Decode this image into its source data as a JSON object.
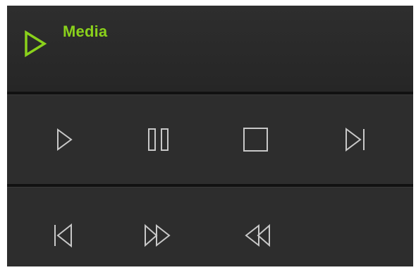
{
  "header": {
    "title": "Media",
    "icon": "play-icon",
    "accent_color": "#8ad11b"
  },
  "controls": {
    "row1": [
      "play-icon",
      "pause-icon",
      "stop-icon",
      "skip-next-icon"
    ],
    "row2": [
      "skip-previous-icon",
      "fast-forward-icon",
      "rewind-icon"
    ],
    "icon_color": "#c8c8c8"
  }
}
